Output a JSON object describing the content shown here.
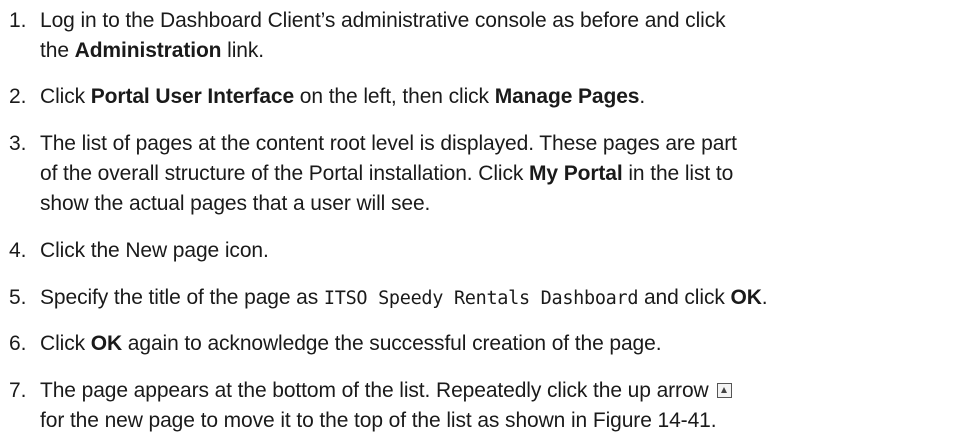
{
  "steps": [
    {
      "number": "1.",
      "a": "Log in to the Dashboard Client’s administrative console as before and click",
      "b": "the ",
      "bold1": "Administration",
      "c": " link."
    },
    {
      "number": "2.",
      "a": "Click ",
      "bold1": "Portal User Interface",
      "b": " on the left, then click ",
      "bold2": "Manage Pages",
      "c": "."
    },
    {
      "number": "3.",
      "a": "The list of pages at the content root level is displayed. These pages are part",
      "b": "of the overall structure of the Portal installation. Click ",
      "bold1": "My Portal",
      "c": " in the list to",
      "d": "show the actual pages that a user will see."
    },
    {
      "number": "4.",
      "a": "Click the New page icon."
    },
    {
      "number": "5.",
      "a": "Specify the title of the page as ",
      "code": "ITSO Speedy Rentals Dashboard",
      "b": " and click ",
      "bold1": "OK",
      "c": "."
    },
    {
      "number": "6.",
      "a": "Click ",
      "bold1": "OK",
      "b": " again to acknowledge the successful creation of the page."
    },
    {
      "number": "7.",
      "a": "The page appears at the bottom of the list. Repeatedly click the up arrow",
      "b": "for the new page to move it to the top of the list as shown in Figure 14-41.",
      "icon": "up-arrow-icon"
    }
  ]
}
